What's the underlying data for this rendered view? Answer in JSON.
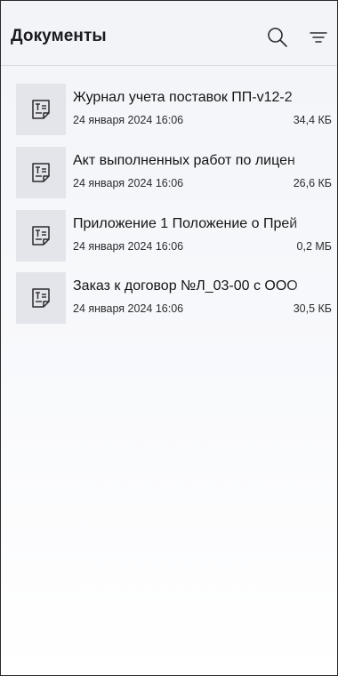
{
  "header": {
    "title": "Документы",
    "search_icon": "search-icon",
    "filter_icon": "filter-icon"
  },
  "documents": [
    {
      "title": "Журнал учета поставок ПП-v12-2",
      "date": "24 января 2024 16:06",
      "size": "34,4 КБ",
      "icon": "text-document-icon"
    },
    {
      "title": "Акт выполненных работ по лицен",
      "date": "24 января 2024 16:06",
      "size": "26,6 КБ",
      "icon": "text-document-icon"
    },
    {
      "title": "Приложение 1 Положение о Прей",
      "date": "24 января 2024 16:06",
      "size": "0,2 МБ",
      "icon": "text-document-icon"
    },
    {
      "title": "Заказ к договор №Л_03-00 с ООО",
      "date": "24 января 2024 16:06",
      "size": "30,5 КБ",
      "icon": "text-document-icon"
    }
  ],
  "colors": {
    "text": "#141414",
    "thumb_bg": "#e3e5ea",
    "divider": "#d3d8e0"
  }
}
